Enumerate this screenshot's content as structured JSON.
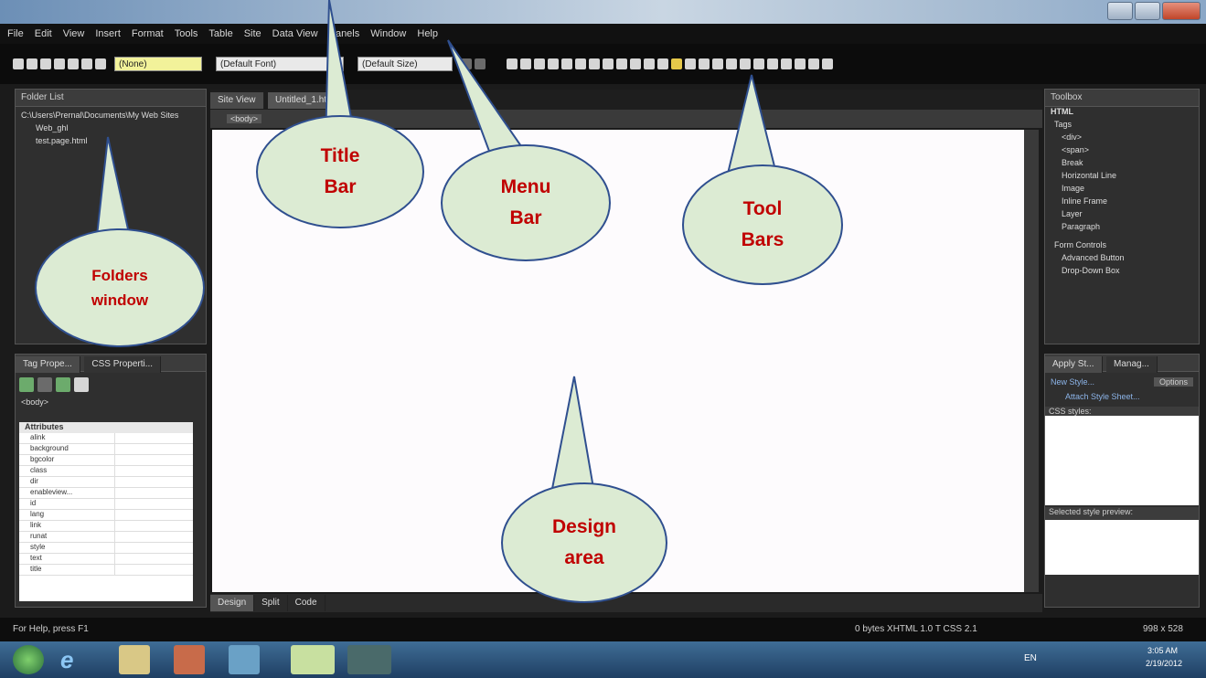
{
  "menu": [
    "File",
    "Edit",
    "View",
    "Insert",
    "Format",
    "Tools",
    "Table",
    "Site",
    "Data View",
    "Panels",
    "Window",
    "Help"
  ],
  "toolbar": {
    "style_select": "(None)",
    "font_select": "(Default Font)",
    "size_select": "(Default Size)"
  },
  "folders": {
    "title": "Folder List",
    "path": "C:\\Users\\Prernal\\Documents\\My Web Sites",
    "items": [
      "Web_ghl",
      "test.page.html"
    ]
  },
  "design": {
    "tabs": [
      "Site View",
      "Untitled_1.htm"
    ],
    "breadcrumb": "<body>",
    "bottom_tabs": [
      "Design",
      "Split",
      "Code"
    ]
  },
  "tag_panel": {
    "tabs": [
      "Tag Prope...",
      "CSS Properti..."
    ],
    "label": "<body>",
    "section": "Attributes",
    "attributes": [
      "alink",
      "background",
      "bgcolor",
      "class",
      "dir",
      "enableview...",
      "id",
      "lang",
      "link",
      "runat",
      "style",
      "text",
      "title"
    ]
  },
  "toolbox": {
    "title": "Toolbox",
    "section": "HTML",
    "group": "Tags",
    "items": [
      "<div>",
      "<span>",
      "Break",
      "Horizontal Line",
      "Image",
      "Inline Frame",
      "Layer",
      "Paragraph"
    ],
    "group2": "Form Controls",
    "items2": [
      "Advanced Button",
      "Drop-Down Box"
    ]
  },
  "apply_panel": {
    "tabs": [
      "Apply St...",
      "Manag..."
    ],
    "new_style": "New Style...",
    "options": "Options",
    "attach": "Attach Style Sheet...",
    "css_styles": "CSS styles:",
    "selected_preview": "Selected style preview:"
  },
  "status": {
    "left": "For Help, press F1",
    "mid": "0 bytes  XHTML 1.0 T  CSS 2.1",
    "right": "998 x 528"
  },
  "tray": {
    "lang": "EN",
    "time": "3:05 AM",
    "date": "2/19/2012"
  },
  "callouts": [
    {
      "id": "title-bar",
      "text": "Title\nBar"
    },
    {
      "id": "menu-bar",
      "text": "Menu\nBar"
    },
    {
      "id": "tool-bars",
      "text": "Tool\nBars"
    },
    {
      "id": "folders-window",
      "text": "Folders\nwindow"
    },
    {
      "id": "design-area",
      "text": "Design\narea"
    }
  ]
}
